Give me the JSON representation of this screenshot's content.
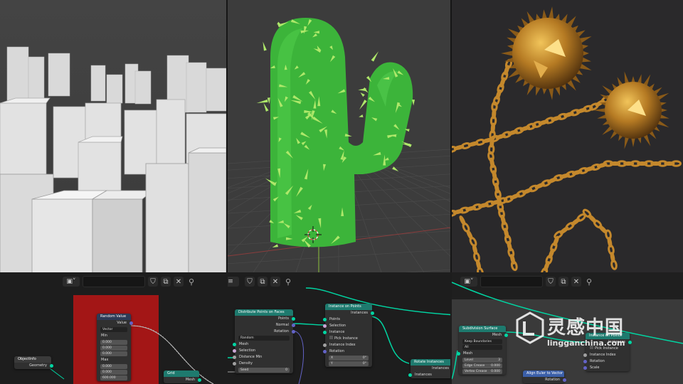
{
  "viewports": [
    {
      "name": "city"
    },
    {
      "name": "cactus"
    },
    {
      "name": "chains"
    }
  ],
  "editor1": {
    "nodes": {
      "object_info": {
        "title": "ObjectInfo",
        "output": "Geometry"
      },
      "random_value": {
        "title": "Random Value",
        "output": "Value",
        "dtype": "Vector",
        "fields": [
          "0.000",
          "0.000",
          "0.000",
          "0.000",
          "0.000",
          "600.000"
        ],
        "labels": [
          "Min",
          "Max"
        ]
      },
      "grid": {
        "title": "Grid",
        "output": "Mesh"
      }
    }
  },
  "editor2": {
    "nodes": {
      "distribute": {
        "title": "Distribute Points on Faces",
        "outputs": [
          "Points",
          "Normal",
          "Rotation"
        ],
        "mode": "Random",
        "inputs": [
          "Mesh",
          "Selection",
          "Distance Min",
          "Density",
          "Seed"
        ],
        "seed_value": "0"
      },
      "instance": {
        "title": "Instance on Points",
        "output": "Instances",
        "inputs": [
          "Points",
          "Selection",
          "Instance",
          "Pick Instance",
          "Instance Index",
          "Rotation"
        ],
        "rot_fields": [
          "X",
          "Y"
        ],
        "rot_values": [
          "0°",
          "0°"
        ]
      },
      "rotate": {
        "title": "Rotate Instances",
        "output": "Instances",
        "input": "Instances"
      }
    }
  },
  "editor3": {
    "nodes": {
      "subdivision": {
        "title": "Subdivision Surface",
        "output": "Mesh",
        "mode": "Keep Boundaries",
        "uv": "All",
        "inputs": [
          "Mesh",
          "Level",
          "Edge Crease",
          "Vertex Crease"
        ],
        "values": [
          "3",
          "0.000",
          "0.000"
        ]
      },
      "instance": {
        "title": "Instance on Points",
        "output": "Instances",
        "inputs": [
          "Pick Instance",
          "Instance Index",
          "Rotation",
          "Scale"
        ]
      },
      "align": {
        "title": "Align Euler to Vector",
        "output": "Rotation"
      }
    }
  },
  "watermark": {
    "brand_cn": "灵感中国",
    "url": "lingganchina.com"
  },
  "colors": {
    "cactus": "#3fb43c",
    "geometry_socket": "#00d6a3",
    "node_bg": "#303030",
    "frame_red": "#a31414"
  }
}
